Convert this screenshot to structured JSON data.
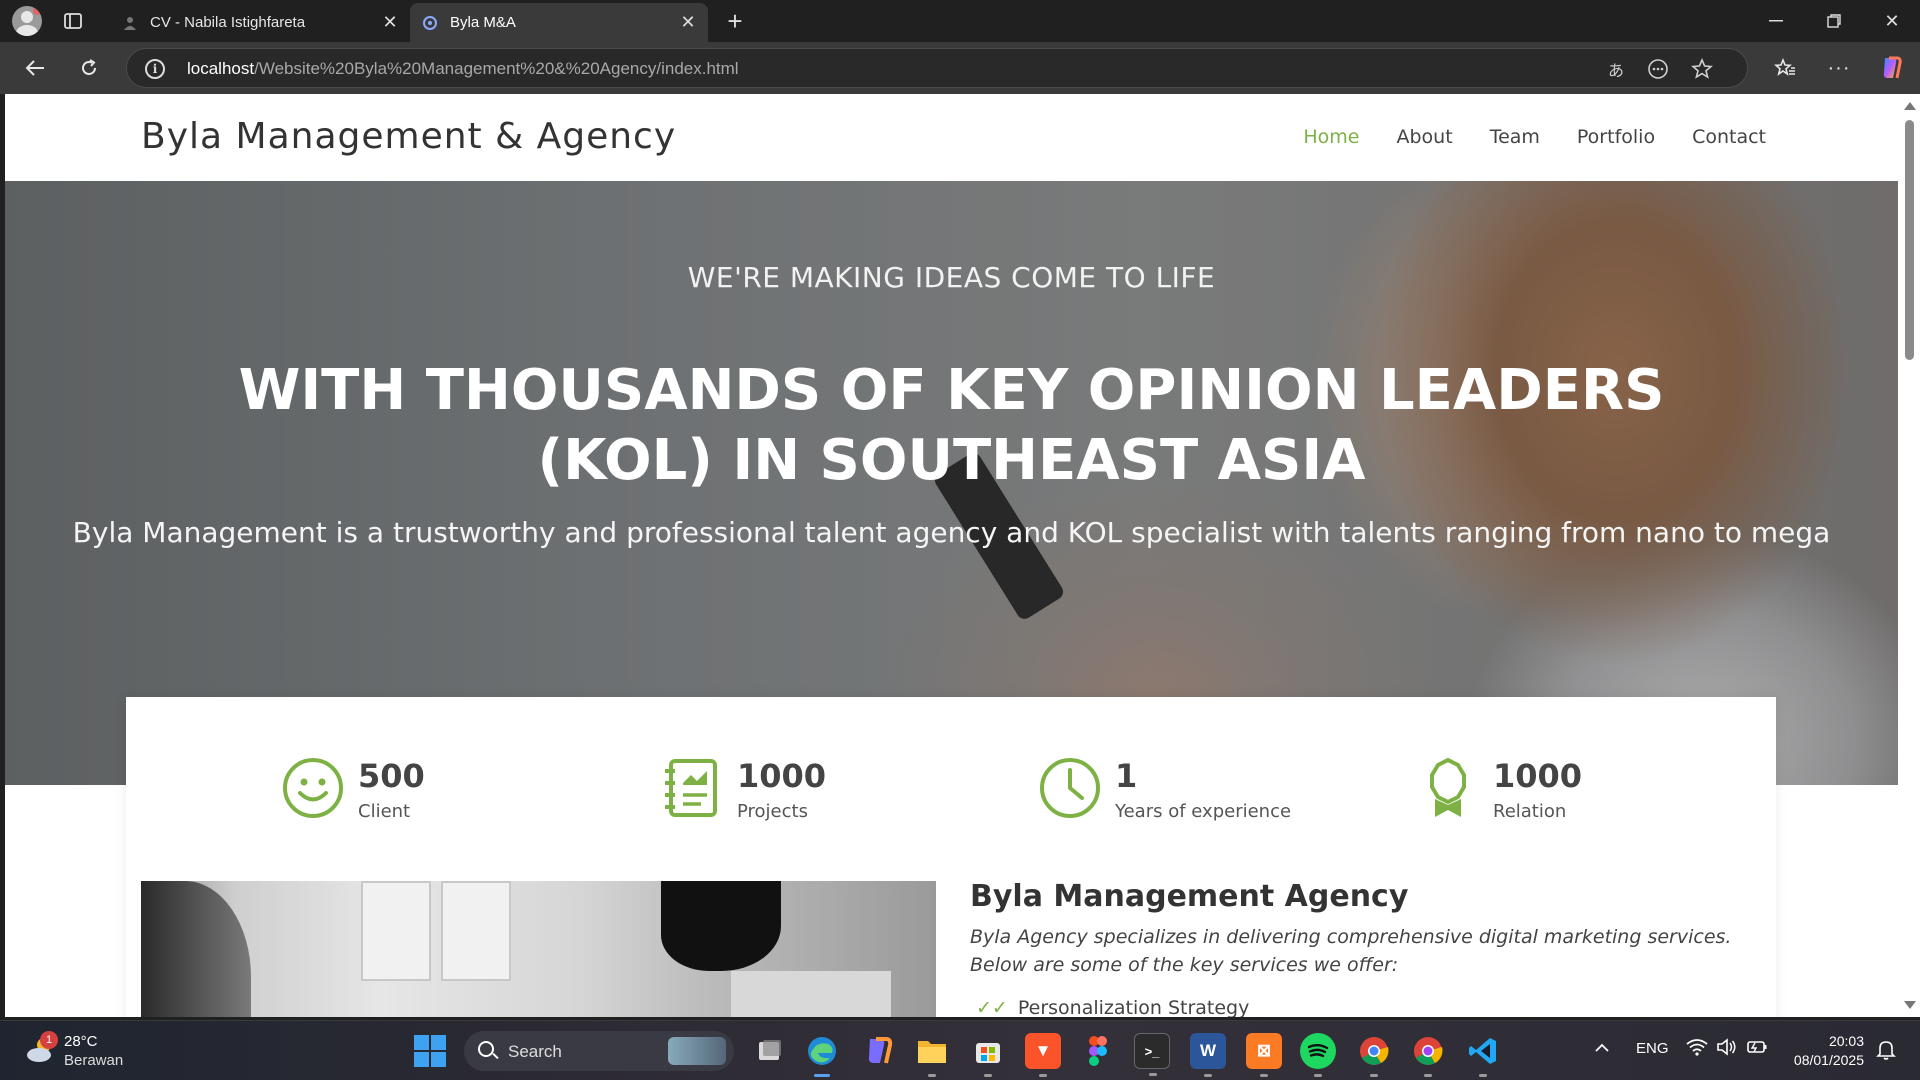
{
  "browser": {
    "tabs": [
      {
        "title": "CV - Nabila Istighfareta",
        "active": false
      },
      {
        "title": "Byla M&A",
        "active": true
      }
    ],
    "url_host": "localhost",
    "url_path": "/Website%20Byla%20Management%20&%20Agency/index.html"
  },
  "site": {
    "brand": "Byla Management & Agency",
    "nav": [
      {
        "label": "Home",
        "active": true
      },
      {
        "label": "About",
        "active": false
      },
      {
        "label": "Team",
        "active": false
      },
      {
        "label": "Portfolio",
        "active": false
      },
      {
        "label": "Contact",
        "active": false
      }
    ],
    "accent_color": "#7eb144"
  },
  "hero": {
    "eyebrow": "WE'RE MAKING IDEAS COME TO LIFE",
    "title": "WITH THOUSANDS OF KEY OPINION LEADERS (KOL) IN SOUTHEAST ASIA",
    "subtitle": "Byla Management is a trustworthy and professional talent agency and KOL specialist with talents ranging from nano to mega"
  },
  "stats": [
    {
      "icon": "smiley-icon",
      "value": "500",
      "label": "Client"
    },
    {
      "icon": "notebook-chart-icon",
      "value": "1000",
      "label": "Projects"
    },
    {
      "icon": "clock-icon",
      "value": "1",
      "label": "Years of experience"
    },
    {
      "icon": "award-ribbon-icon",
      "value": "1000",
      "label": "Relation"
    }
  ],
  "about": {
    "title": "Byla Management Agency",
    "description": "Byla Agency specializes in delivering comprehensive digital marketing services. Below are some of the key services we offer:",
    "first_item": "Personalization Strategy"
  },
  "taskbar": {
    "weather_temp": "28°C",
    "weather_condition": "Berawan",
    "weather_badge": "1",
    "search_placeholder": "Search",
    "language": "ENG",
    "time": "20:03",
    "date": "08/01/2025"
  }
}
